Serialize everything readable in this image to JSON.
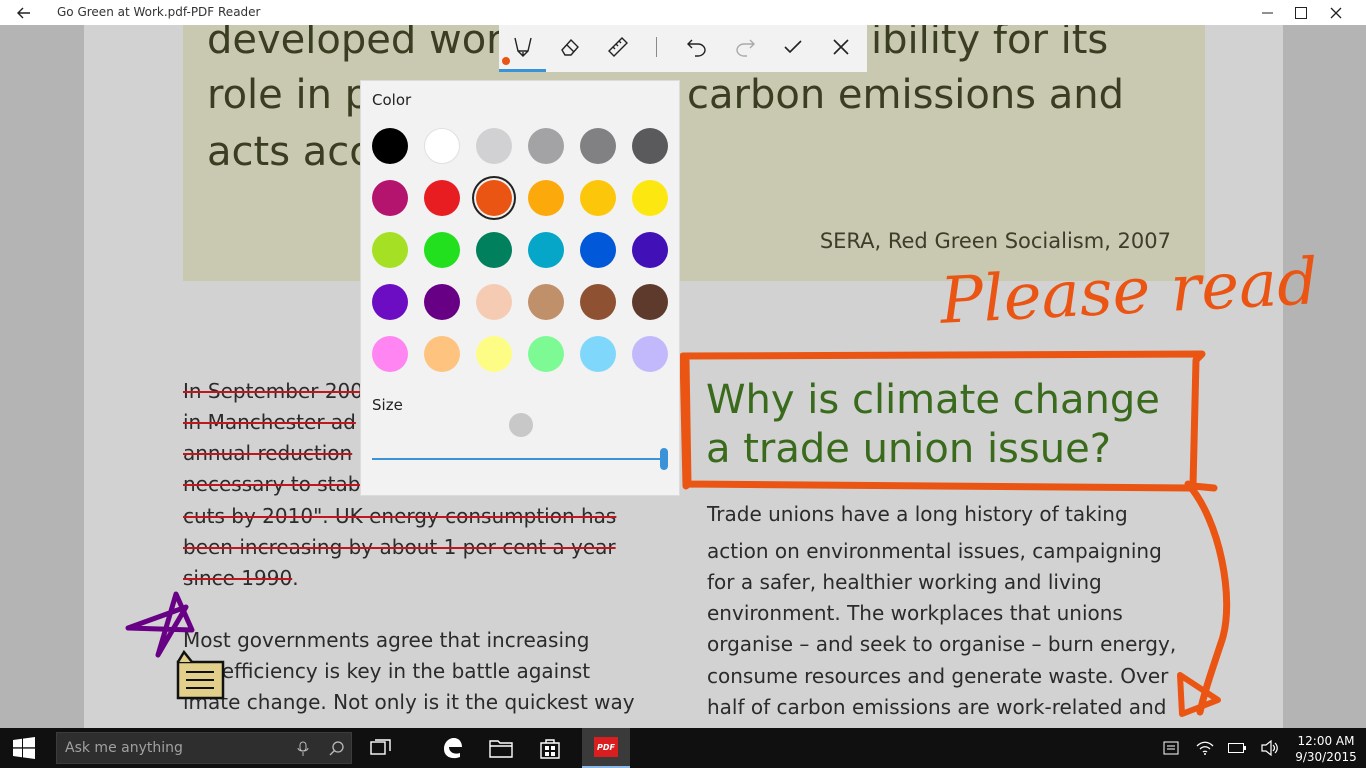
{
  "window": {
    "title": "Go Green at Work.pdf-PDF Reader"
  },
  "document": {
    "quote_lines": [
      "developed wor",
      "ibility for its",
      "role in p",
      "carbon emissions and",
      "acts acc"
    ],
    "quote_source": "SERA, Red Green Socialism, 2007",
    "left_column_struck": [
      "In September 200",
      "in Manchester ad",
      "annual reduction",
      "necessary to stab",
      "cuts by 2010\". UK energy consumption has",
      "been increasing by about 1 per cent a year",
      "since 1990"
    ],
    "left_column_struck_tail": ".",
    "left_column_para2": [
      "Most governments agree that increasing",
      "rgy efficiency is key in the battle against",
      "imate change. Not only is it the quickest way"
    ],
    "heading": [
      "Why is climate change",
      "a trade union issue?"
    ],
    "right_column": [
      "Trade unions have a long history of taking",
      "action on environmental issues, campaigning",
      "for a safer, healthier working and living",
      "environment. The workplaces that unions",
      "organise – and seek to organise – burn energy,",
      "consume resources and generate waste. Over",
      "half of carbon emissions are work-related and"
    ],
    "handwritten_note": "Please read"
  },
  "ink_toolbar": {
    "tools": [
      "pen-icon",
      "eraser-icon",
      "ruler-icon",
      "undo-icon",
      "redo-icon",
      "accept-icon",
      "close-icon"
    ],
    "active_tool": "pen",
    "active_color": "#ea5514"
  },
  "color_flyout": {
    "color_label": "Color",
    "size_label": "Size",
    "selected_color": "#ea5514",
    "size_level": 1.0,
    "swatches": [
      [
        "#000000",
        "#ffffff",
        "#d1d1d3",
        "#a3a3a6",
        "#818184",
        "#5a5a5c"
      ],
      [
        "#b4146e",
        "#e81d22",
        "#ea5514",
        "#fcaa0b",
        "#fcc70b",
        "#fde711"
      ],
      [
        "#a6e024",
        "#22e01d",
        "#01805e",
        "#05a6c8",
        "#0159d9",
        "#4110b6"
      ],
      [
        "#6c0dc3",
        "#680086",
        "#f6cbb4",
        "#c0906b",
        "#8e5232",
        "#5e3a2d"
      ],
      [
        "#fe85f2",
        "#ffc380",
        "#fdfd86",
        "#7dfa94",
        "#7fd8fb",
        "#c1b9fc"
      ]
    ]
  },
  "taskbar": {
    "search_placeholder": "Ask me anything",
    "pinned": [
      "task-view-icon",
      "edge-icon",
      "file-explorer-icon",
      "store-icon",
      "pdf-reader-icon"
    ],
    "pdf_label": "PDF",
    "tray": [
      "action-center-icon",
      "wifi-icon",
      "battery-icon",
      "volume-icon"
    ],
    "time": "12:00 AM",
    "date": "9/30/2015"
  }
}
